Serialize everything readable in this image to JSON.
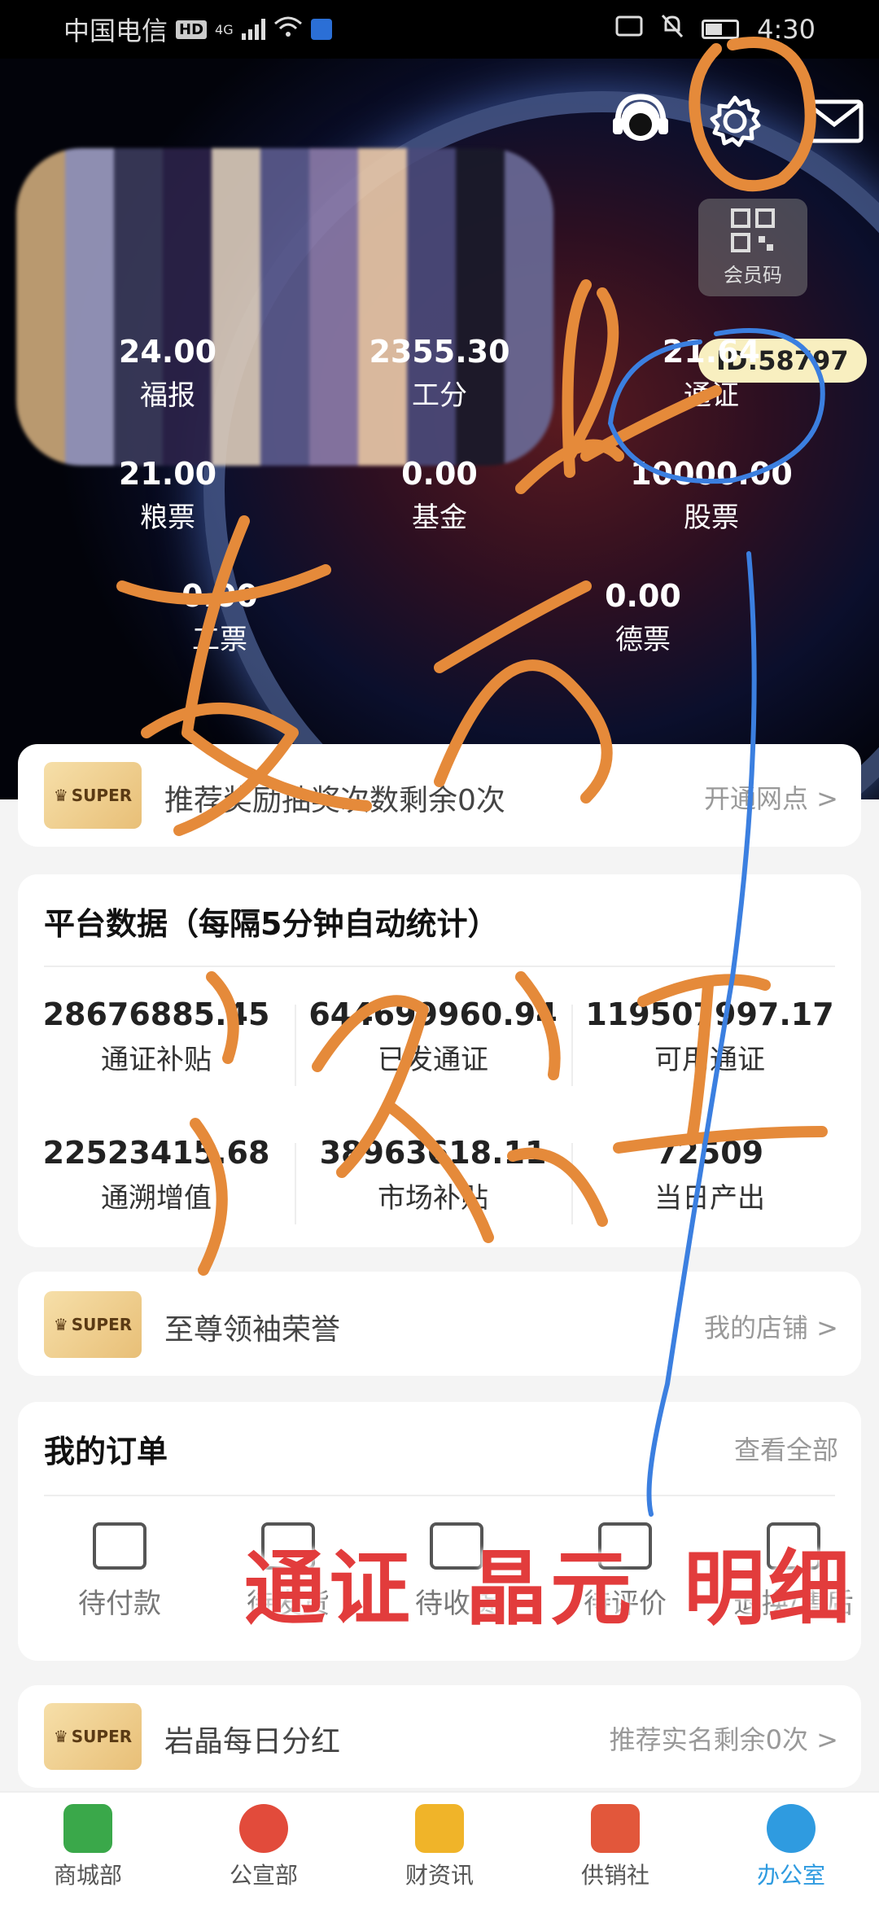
{
  "status_bar": {
    "carrier": "中国电信",
    "hd": "HD",
    "net": "4G",
    "time": "4:30"
  },
  "hero": {
    "qr_label": "会员码",
    "id_badge": "ID:58797",
    "stats": [
      {
        "value": "24.00",
        "label": "福报"
      },
      {
        "value": "2355.30",
        "label": "工分"
      },
      {
        "value": "21.64",
        "label": "通证"
      },
      {
        "value": "21.00",
        "label": "粮票"
      },
      {
        "value": "0.00",
        "label": "基金"
      },
      {
        "value": "10000.00",
        "label": "股票"
      },
      {
        "value": "0.00",
        "label": "工票"
      },
      {
        "value": "0.00",
        "label": "德票"
      }
    ]
  },
  "banner1": {
    "badge": "SUPER",
    "text": "推荐奖励抽奖次数剩余0次",
    "link": "开通网点 >"
  },
  "platform": {
    "title": "平台数据（每隔5分钟自动统计）",
    "cells": [
      {
        "value": "28676885.45",
        "label": "通证补贴"
      },
      {
        "value": "644699960.94",
        "label": "已发通证"
      },
      {
        "value": "119507997.17",
        "label": "可用通证"
      },
      {
        "value": "22523415.68",
        "label": "通溯增值"
      },
      {
        "value": "38963618.11",
        "label": "市场补贴"
      },
      {
        "value": "72509",
        "label": "当日产出"
      }
    ]
  },
  "banner2": {
    "badge": "SUPER",
    "text": "至尊领袖荣誉",
    "link": "我的店铺 >"
  },
  "orders": {
    "title": "我的订单",
    "link": "查看全部",
    "items": [
      {
        "label": "待付款",
        "icon": "wallet-icon"
      },
      {
        "label": "待发货",
        "icon": "box-icon"
      },
      {
        "label": "待收货",
        "icon": "receive-icon"
      },
      {
        "label": "待评价",
        "icon": "review-icon"
      },
      {
        "label": "退换/售后",
        "icon": "return-icon"
      }
    ]
  },
  "banner3": {
    "badge": "SUPER",
    "text": "岩晶每日分红",
    "link": "推荐实名剩余0次 >"
  },
  "overlay_text": {
    "t1": "通证",
    "t2": "晶元",
    "t3": "明细"
  },
  "tabs": [
    {
      "label": "商城部",
      "color": "#3aa84a"
    },
    {
      "label": "公宣部",
      "color": "#e24b3b"
    },
    {
      "label": "财资讯",
      "color": "#f0b429"
    },
    {
      "label": "供销社",
      "color": "#e2573b"
    },
    {
      "label": "办公室",
      "color": "#2f9be0"
    }
  ],
  "colors": {
    "accent": "#2f9be0",
    "scribble_orange": "#e58a3a",
    "scribble_blue": "#3b7fe0",
    "overlay_red": "#e23c3c"
  }
}
